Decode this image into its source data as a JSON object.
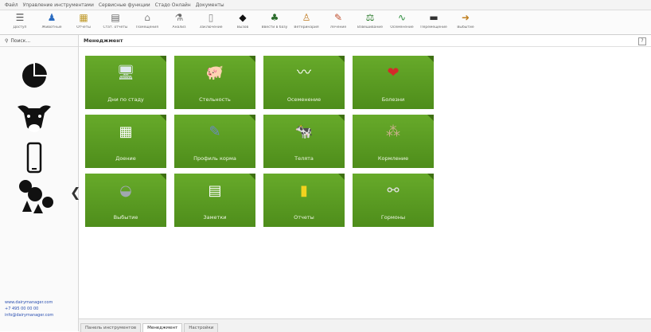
{
  "menubar": [
    "Файл",
    "Управление инструментами",
    "Сервисные функции",
    "Стадо Онлайн",
    "Документы"
  ],
  "toolbar": [
    {
      "icon": "list-icon",
      "label": "Доступ"
    },
    {
      "icon": "person-icon",
      "label": "Животные"
    },
    {
      "icon": "calendar-icon",
      "label": "Отчеты"
    },
    {
      "icon": "chart-icon",
      "label": "Стат. отчеты"
    },
    {
      "icon": "home-icon",
      "label": "Помещения"
    },
    {
      "icon": "flask-icon",
      "label": "Анализ"
    },
    {
      "icon": "document-icon",
      "label": "Заключение"
    },
    {
      "icon": "cow-head-icon",
      "label": "Вызов"
    },
    {
      "icon": "cow-person-icon",
      "label": "Ввести в базу"
    },
    {
      "icon": "stethoscope-icon",
      "label": "Ветеринария"
    },
    {
      "icon": "syringe-icon",
      "label": "Лечение"
    },
    {
      "icon": "scale-icon",
      "label": "Взвешивание"
    },
    {
      "icon": "sperm-icon",
      "label": "Осеменение"
    },
    {
      "icon": "truck-icon",
      "label": "Перемещение"
    },
    {
      "icon": "exit-icon",
      "label": "Выбытие"
    }
  ],
  "sidebar": {
    "search_label": "Поиск...",
    "icons": [
      "pie-chart-icon",
      "cow-icon",
      "phone-icon",
      "people-group-icon"
    ],
    "collapse_glyph": "❮",
    "links": [
      "www.dairymanager.com",
      "+7 495 00 00 00",
      "info@dairymanager.com"
    ]
  },
  "main": {
    "title": "Менеджмент",
    "help": "?",
    "tiles": [
      {
        "name": "tile-herd-days",
        "icon": "monitor-icon",
        "glyph": "🖥",
        "label": "Дни по стаду"
      },
      {
        "name": "tile-pregnancy",
        "icon": "pig-icon",
        "glyph": "🐖",
        "label": "Стельность"
      },
      {
        "name": "tile-insemination",
        "icon": "sperm-icon",
        "glyph": "〰",
        "label": "Осеменение"
      },
      {
        "name": "tile-diseases",
        "icon": "heart-icon",
        "glyph": "❤",
        "label": "Болезни"
      },
      {
        "name": "tile-milking",
        "icon": "milk-icon",
        "glyph": "▦",
        "label": "Доение"
      },
      {
        "name": "tile-feed-profile",
        "icon": "syringe-icon",
        "glyph": "✎",
        "label": "Профиль корма"
      },
      {
        "name": "tile-calves",
        "icon": "cow-icon",
        "glyph": "🐄",
        "label": "Телята"
      },
      {
        "name": "tile-feeding",
        "icon": "grain-icon",
        "glyph": "⁂",
        "label": "Кормление"
      },
      {
        "name": "tile-culling",
        "icon": "fish-icon",
        "glyph": "◒",
        "label": "Выбытие"
      },
      {
        "name": "tile-notes",
        "icon": "clipboard-icon",
        "glyph": "▤",
        "label": "Заметки"
      },
      {
        "name": "tile-reports",
        "icon": "battery-icon",
        "glyph": "▮",
        "label": "Отчеты"
      },
      {
        "name": "tile-hormones",
        "icon": "molecule-icon",
        "glyph": "⚯",
        "label": "Гормоны"
      }
    ]
  },
  "bottom_tabs": [
    {
      "label": "Панель инструментов",
      "active": false
    },
    {
      "label": "Менеджмент",
      "active": true
    },
    {
      "label": "Настройки",
      "active": false
    }
  ],
  "colors": {
    "tile_green": "#5a9b22",
    "tile_corner": "#3e7012",
    "background": "#ffffff"
  }
}
